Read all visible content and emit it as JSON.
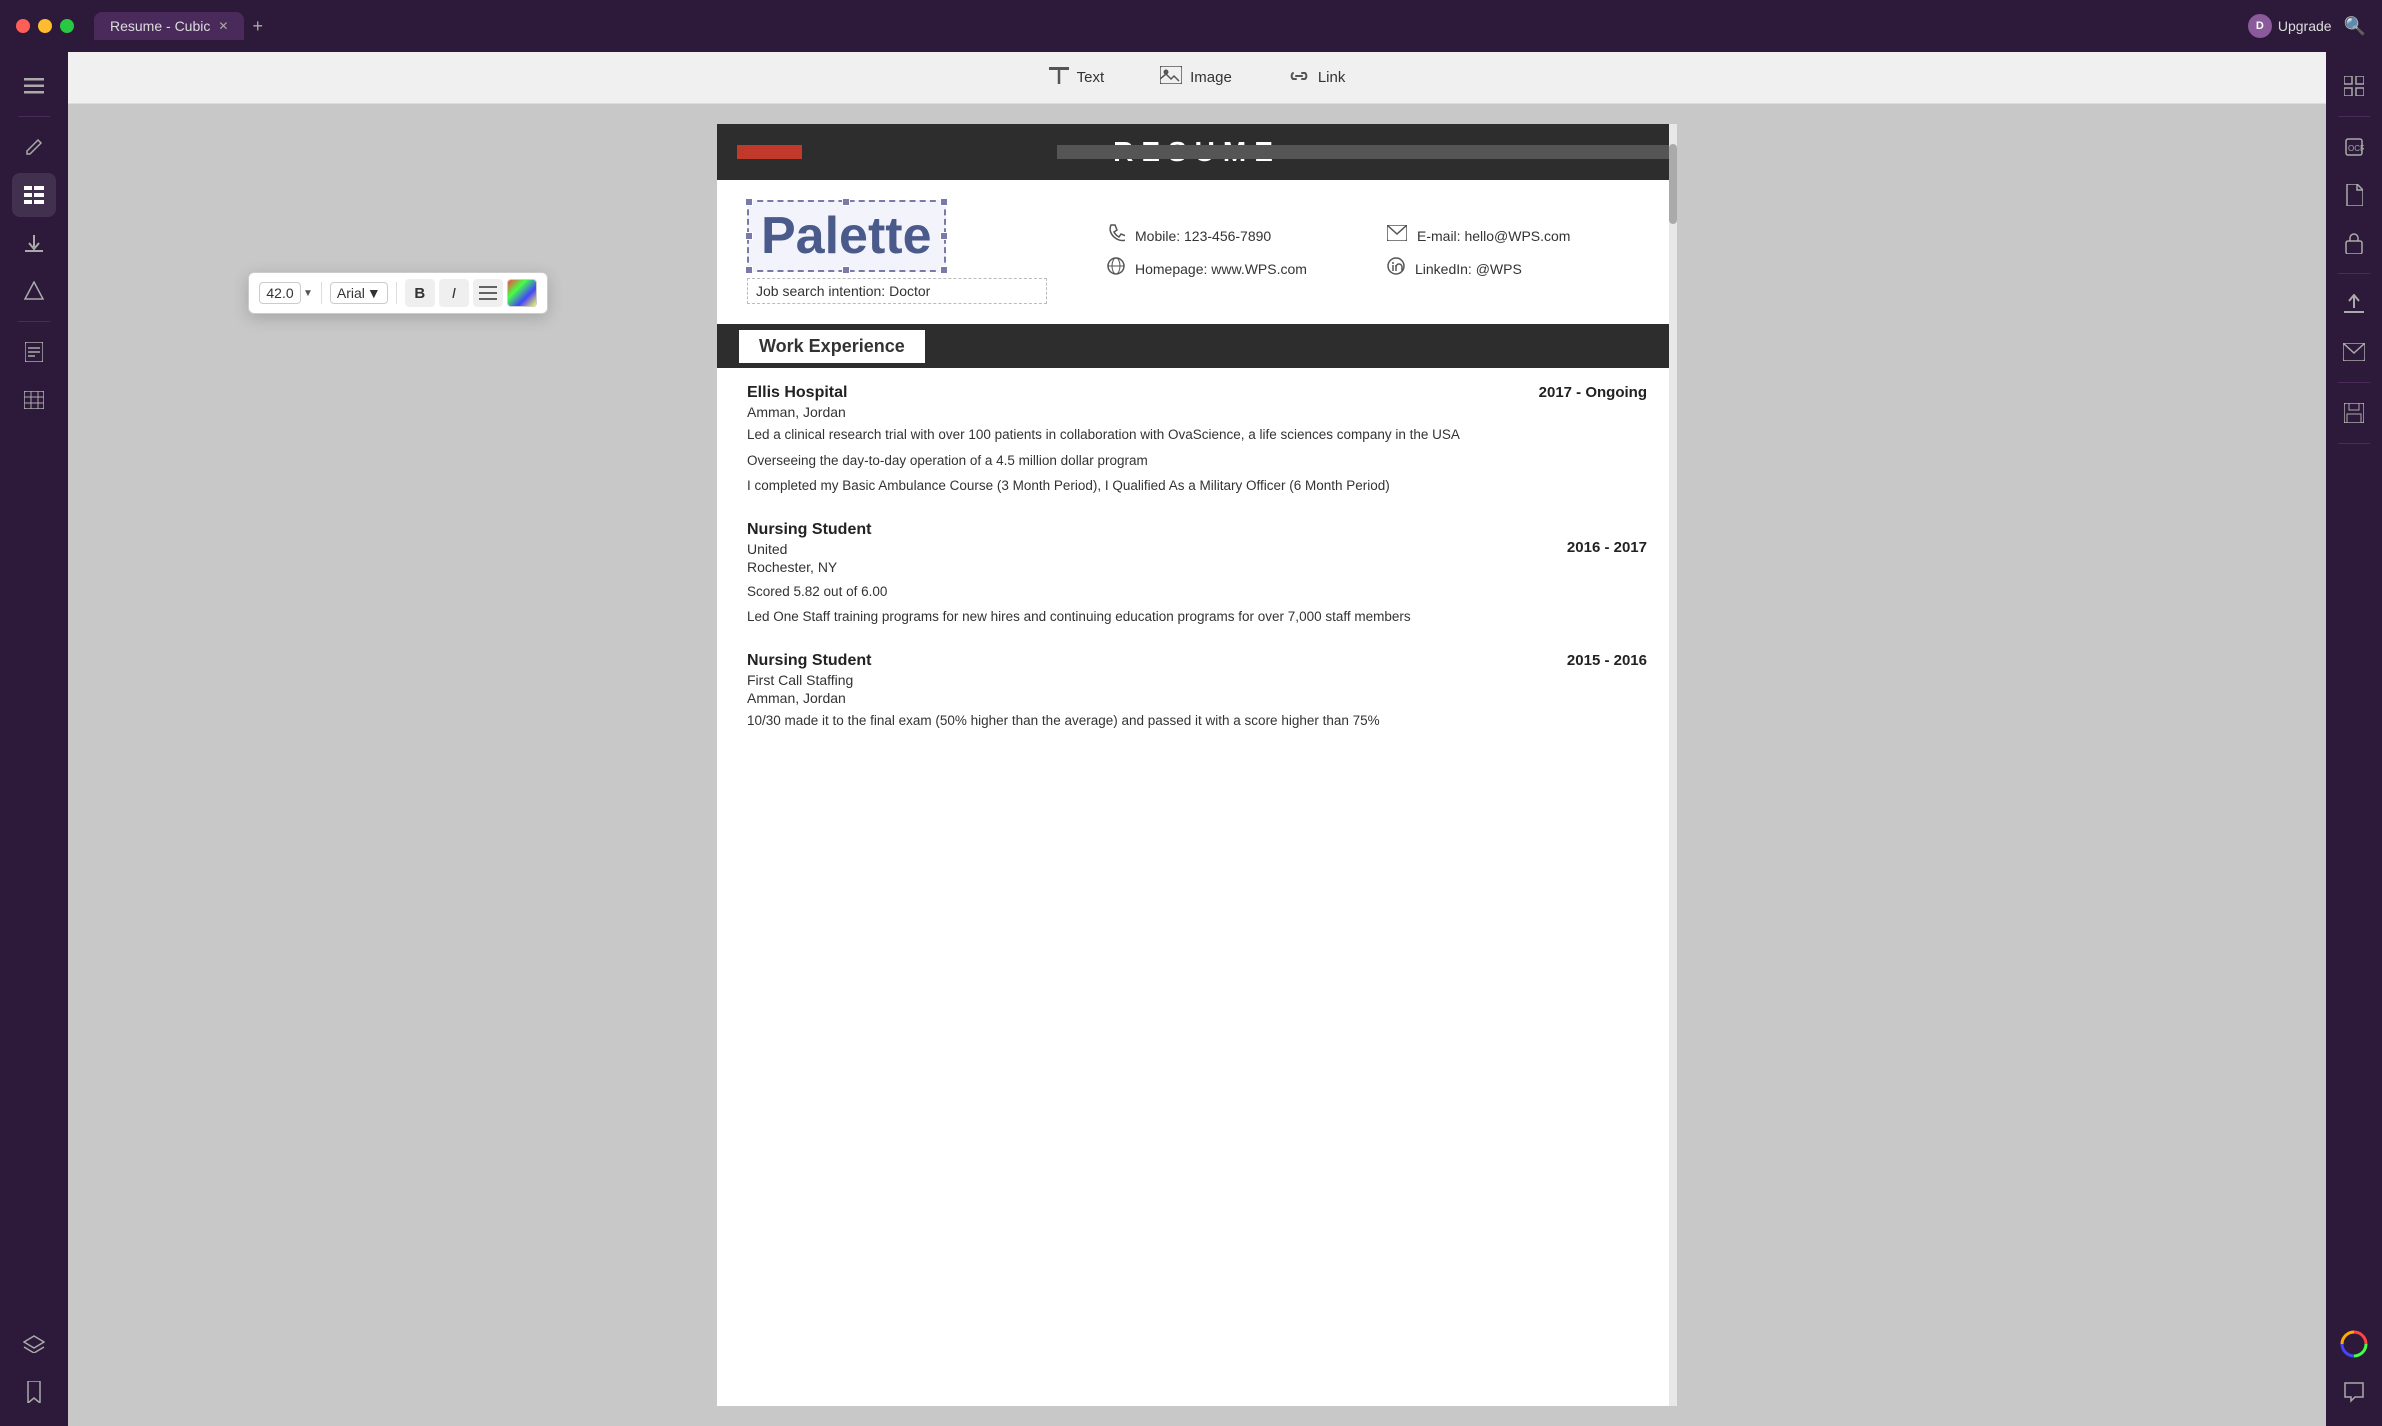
{
  "titlebar": {
    "tab_label": "Resume - Cubic",
    "upgrade_label": "Upgrade",
    "user_initial": "D"
  },
  "toolbar": {
    "text_label": "Text",
    "image_label": "Image",
    "link_label": "Link"
  },
  "floating_toolbar": {
    "font_size": "42.0",
    "font_name": "Arial",
    "bold_label": "B",
    "italic_label": "I"
  },
  "resume": {
    "header_title": "RESUME",
    "name": "Palette",
    "job_intention": "Job search intention:  Doctor",
    "mobile_label": "Mobile: 123-456-7890",
    "email_label": "E-mail: hello@WPS.com",
    "homepage_label": "Homepage: www.WPS.com",
    "linkedin_label": "LinkedIn: @WPS",
    "section_work": "Work Experience",
    "jobs": [
      {
        "employer": "Ellis Hospital",
        "location": "Amman,  Jordan",
        "date": "2017 - Ongoing",
        "desc1": "Led a  clinical research trial with over 100 patients in collaboration with OvaScience, a life sciences company in the USA",
        "desc2": "Overseeing the day-to-day operation of a 4.5 million dollar program",
        "desc3": "I completed my Basic Ambulance Course (3 Month Period), I Qualified As a Military Officer (6 Month Period)"
      },
      {
        "employer": "Nursing Student",
        "location_line1": "United",
        "location_line2": "Rochester, NY",
        "date": "2016 - 2017",
        "desc1": "Scored 5.82 out of 6.00",
        "desc2": "Led  One  Staff  training  programs  for  new hires and continuing education programs for over 7,000 staff members"
      },
      {
        "employer": "Nursing Student",
        "location": "First Call Staffing",
        "location2": "Amman,  Jordan",
        "date": "2015 - 2016",
        "desc1": "10/30  made it to the final exam (50% higher than the average) and passed it with a score  higher than 75%"
      }
    ]
  },
  "sidebar": {
    "icons": [
      "≡",
      "✎",
      "☰",
      "⬇",
      "⬡",
      "📋"
    ],
    "bottom_icons": [
      "◈",
      "🔖"
    ]
  },
  "right_sidebar": {
    "icons": [
      "⊞",
      "📄",
      "🔒",
      "⬆",
      "✉",
      "💾",
      "🎯"
    ]
  }
}
